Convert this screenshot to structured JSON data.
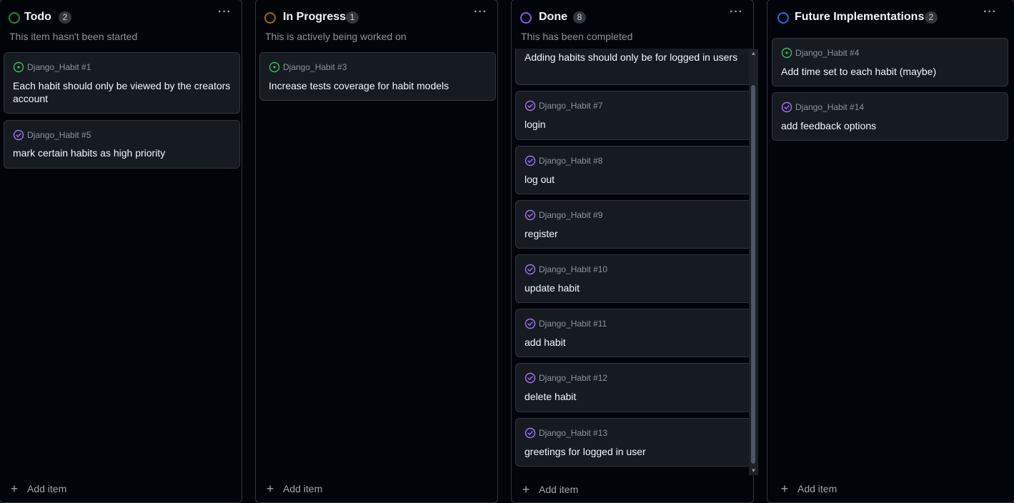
{
  "colors": {
    "background": "#010409",
    "card": "#161b22",
    "open_green": "#3fb950",
    "done_purple": "#a371f7",
    "todo_green": "#238636",
    "progress_orange": "#9e6a03",
    "done_circle": "#8957e5",
    "future_blue": "#1f6feb"
  },
  "columns": [
    {
      "title": "Todo",
      "count": "2",
      "description": "This item hasn't been started",
      "add_label": "Add item",
      "status_icon": "circle-icon",
      "cards": [
        {
          "issue": "Django_Habit #1",
          "title": "Each habit should only be viewed by the creators account",
          "state": "open"
        },
        {
          "issue": "Django_Habit #5",
          "title": "mark certain habits as high priority",
          "state": "closed"
        }
      ]
    },
    {
      "title": "In Progress",
      "count": "1",
      "description": "This is actively being worked on",
      "add_label": "Add item",
      "status_icon": "circle-icon",
      "cards": [
        {
          "issue": "Django_Habit #3",
          "title": "Increase tests coverage for habit models",
          "state": "open"
        }
      ]
    },
    {
      "title": "Done",
      "count": "8",
      "description": "This has been completed",
      "add_label": "Add item",
      "status_icon": "circle-icon",
      "cards": [
        {
          "issue": "",
          "title": "Adding habits should only be for logged in users",
          "state": "closed"
        },
        {
          "issue": "Django_Habit #7",
          "title": "login",
          "state": "closed"
        },
        {
          "issue": "Django_Habit #8",
          "title": "log out",
          "state": "closed"
        },
        {
          "issue": "Django_Habit #9",
          "title": "register",
          "state": "closed"
        },
        {
          "issue": "Django_Habit #10",
          "title": "update habit",
          "state": "closed"
        },
        {
          "issue": "Django_Habit #11",
          "title": "add habit",
          "state": "closed"
        },
        {
          "issue": "Django_Habit #12",
          "title": "delete habit",
          "state": "closed"
        },
        {
          "issue": "Django_Habit #13",
          "title": "greetings for logged in user",
          "state": "closed"
        }
      ]
    },
    {
      "title": "Future Implementations",
      "count": "2",
      "description": "",
      "add_label": "Add item",
      "status_icon": "circle-icon",
      "cards": [
        {
          "issue": "Django_Habit #4",
          "title": "Add time set to each habit (maybe)",
          "state": "open"
        },
        {
          "issue": "Django_Habit #14",
          "title": "add feedback options",
          "state": "closed"
        }
      ]
    }
  ]
}
